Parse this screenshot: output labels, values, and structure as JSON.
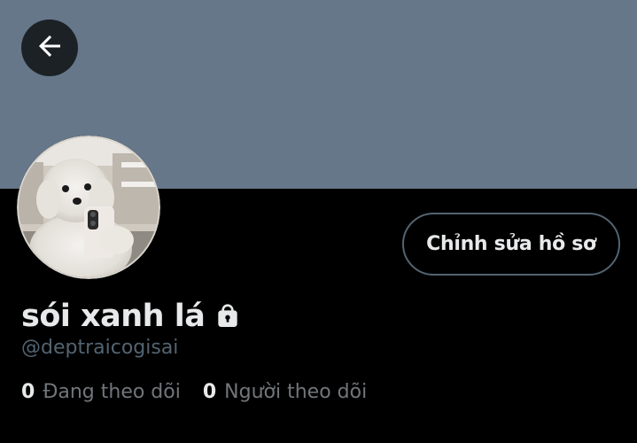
{
  "colors": {
    "banner": "#66778a",
    "background": "#000000",
    "primary_text": "#e7e9ea",
    "secondary_text": "#71767b",
    "button_border": "#536471"
  },
  "header": {
    "back_icon": "arrow-left-icon"
  },
  "profile": {
    "display_name": "sói xanh lá",
    "protected_icon": "lock-icon",
    "handle": "@deptraicogisai",
    "edit_button_label": "Chỉnh sửa hồ sơ",
    "avatar": "avatar-photo-white-puppy"
  },
  "stats": {
    "following_count": "0",
    "following_label": "Đang theo dõi",
    "followers_count": "0",
    "followers_label": "Người theo dõi"
  }
}
